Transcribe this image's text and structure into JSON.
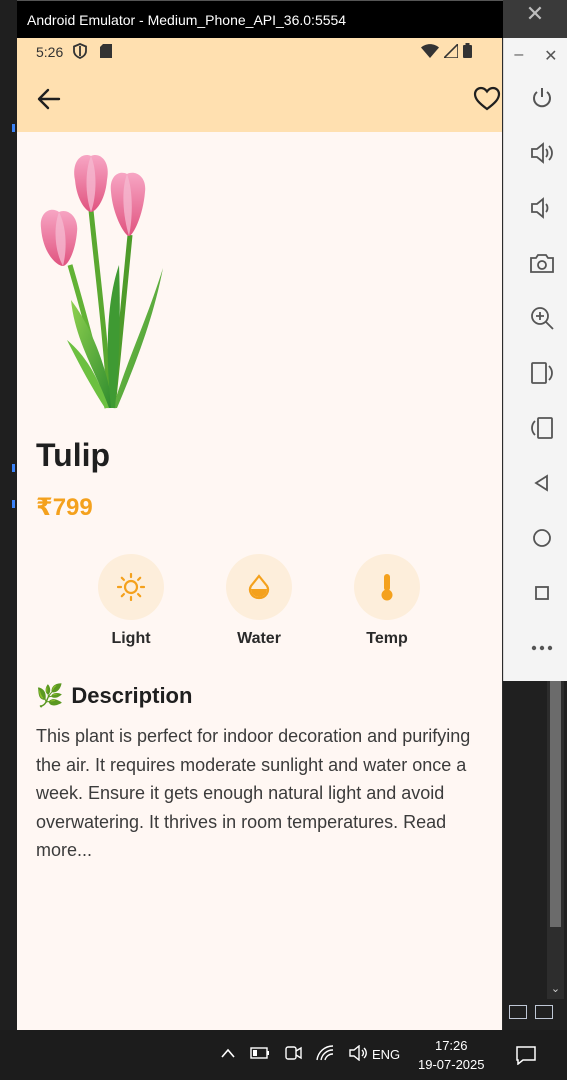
{
  "window": {
    "title": "Android Emulator - Medium_Phone_API_36.0:5554"
  },
  "status_bar": {
    "time": "5:26"
  },
  "product": {
    "name": "Tulip",
    "price": "₹799",
    "image_icon": "tulip-bouquet-image"
  },
  "care": [
    {
      "label": "Light",
      "icon": "sun-icon"
    },
    {
      "label": "Water",
      "icon": "water-drop-icon"
    },
    {
      "label": "Temp",
      "icon": "thermometer-icon"
    }
  ],
  "description": {
    "emoji": "🌿",
    "title": "Description",
    "text": "This plant is perfect for indoor decoration and purifying the air. It requires moderate sunlight and water once a week. Ensure it gets enough natural light and avoid overwatering. It thrives in room temperatures. Read more..."
  },
  "taskbar": {
    "language": "ENG",
    "time": "17:26",
    "date": "19-07-2025"
  },
  "colors": {
    "appbar": "#ffe0b0",
    "screen_bg": "#fff7f3",
    "accent": "#f4a11d",
    "care_circle": "#fdeedb"
  }
}
